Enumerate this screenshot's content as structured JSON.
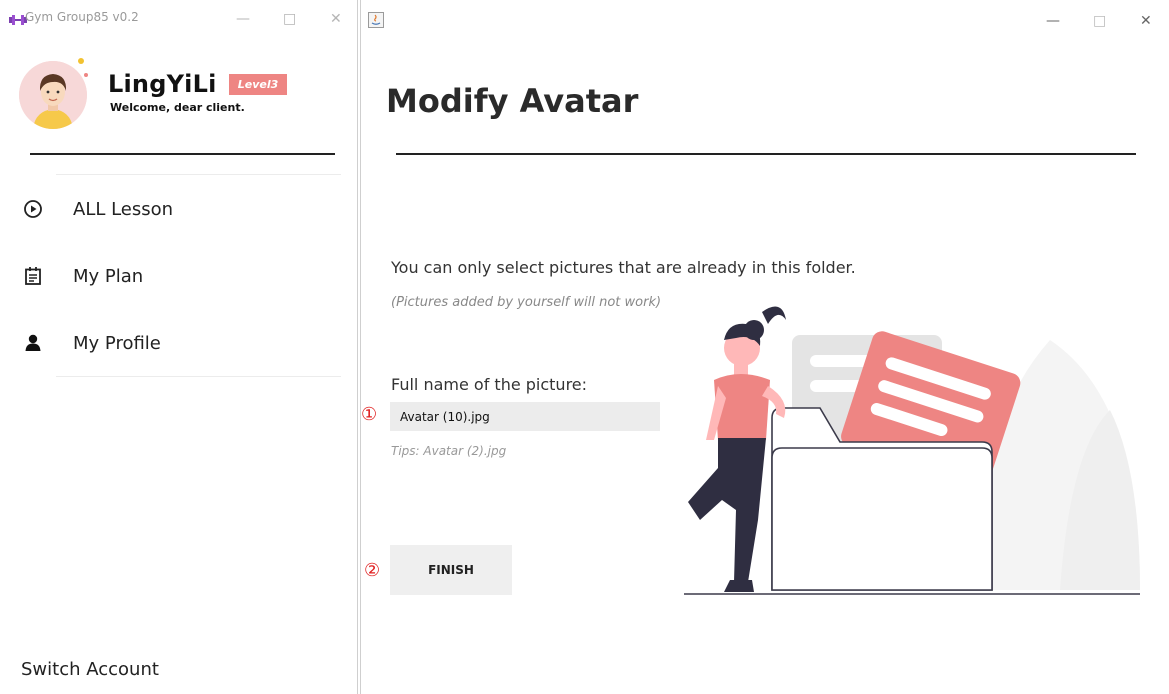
{
  "left_window": {
    "title": "Gym Group85 v0.2",
    "controls": {
      "minimize": "—",
      "maximize": "□",
      "close": "✕"
    },
    "profile": {
      "username": "LingYiLi",
      "level_badge": "Level3",
      "welcome": "Welcome, dear client."
    },
    "nav": [
      {
        "label": "ALL Lesson",
        "icon": "play-circle-icon"
      },
      {
        "label": "My Plan",
        "icon": "calendar-list-icon"
      },
      {
        "label": "My Profile",
        "icon": "person-icon"
      }
    ],
    "switch_account": "Switch Account"
  },
  "right_window": {
    "controls": {
      "minimize": "—",
      "maximize": "□",
      "close": "✕"
    },
    "title": "Modify Avatar",
    "description": "You can only select pictures that are already in this folder.",
    "note": "(Pictures added by yourself will not work)",
    "field_label": "Full name of the picture:",
    "field_value": "Avatar (10).jpg",
    "tips": "Tips: Avatar (2).jpg",
    "finish_label": "FINISH",
    "markers": {
      "input": "①",
      "finish": "②"
    }
  },
  "colors": {
    "accent": "#ee8583",
    "divider": "#222222",
    "input_bg": "#ececec",
    "button_bg": "#efefef",
    "marker": "#e01e1e"
  }
}
